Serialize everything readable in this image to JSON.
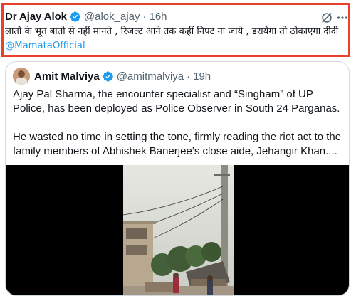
{
  "tweet": {
    "author_name": "Dr Ajay Alok",
    "handle": "@alok_ajay",
    "separator": "·",
    "time": "16h",
    "text": "लातो के भूत बातो से नहीं मानते , रिजल्ट आने तक कहीं निपट ना जाये , डरायेगा तो ठोकाएगा दीदी",
    "mention": "@MamataOfficial",
    "icons": [
      "verified-badge-icon",
      "grok-icon",
      "more-icon"
    ],
    "highlight_color": "#e8412c"
  },
  "quoted_tweet": {
    "author_name": "Amit Malviya",
    "handle": "@amitmalviya",
    "separator": "·",
    "time": "19h",
    "paragraphs": [
      "Ajay Pal Sharma, the encounter specialist and “Singham” of UP Police, has been deployed as Police Observer in South 24 Parganas.",
      "He wasted no time in setting the tone, firmly reading the riot act to the family members of Abhishek Banerjee’s close aide, Jehangir Khan...."
    ]
  },
  "colors": {
    "verified": "#1d9bf0",
    "secondary_text": "#536471",
    "link": "#1d9bf0",
    "border": "#cfd9de"
  }
}
